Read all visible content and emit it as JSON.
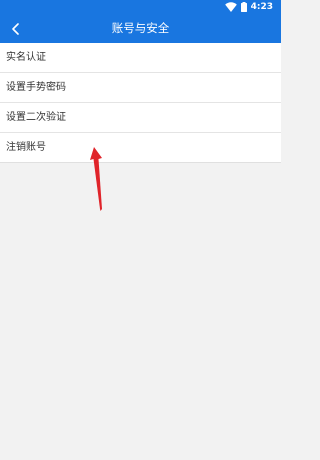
{
  "status_bar": {
    "time": "4:23",
    "icons": [
      "wifi-icon",
      "battery-icon"
    ]
  },
  "header": {
    "title": "账号与安全",
    "back_icon": "back-arrow-icon"
  },
  "menu": {
    "items": [
      {
        "label": "实名认证"
      },
      {
        "label": "设置手势密码"
      },
      {
        "label": "设置二次验证"
      },
      {
        "label": "注销账号"
      }
    ]
  },
  "colors": {
    "accent": "#1976e0",
    "background": "#f2f2f2",
    "annotation": "#e0242a"
  }
}
